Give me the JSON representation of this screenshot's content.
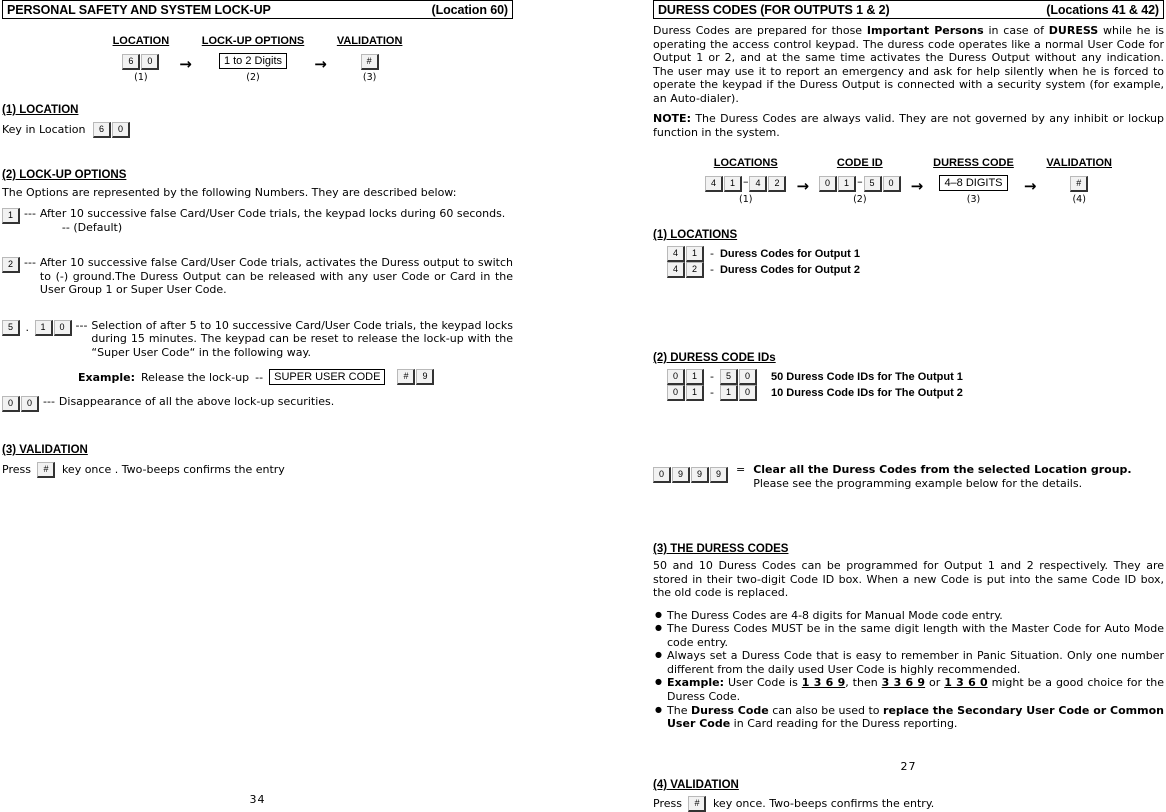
{
  "left": {
    "header": {
      "title": "PERSONAL SAFETY AND SYSTEM LOCK-UP",
      "location": "(Location 60)"
    },
    "flow": [
      {
        "title": "LOCATION",
        "keys": [
          "6",
          "0"
        ],
        "num": "(1)"
      },
      {
        "title": "LOCK-UP OPTIONS",
        "box": "1 to 2 Digits",
        "num": "(2)"
      },
      {
        "title": "VALIDATION",
        "keys": [
          "#"
        ],
        "num": "(3)"
      }
    ],
    "arrow": "→",
    "s1": {
      "heading": "(1) LOCATION",
      "text": "Key in Location",
      "keys": [
        "6",
        "0"
      ]
    },
    "s2": {
      "heading": "(2)  LOCK-UP OPTIONS",
      "intro": "The Options are represented by the following Numbers. They are described below:",
      "opt1": {
        "keys": [
          "1"
        ],
        "dots": "---",
        "text": "After 10 successive false Card/User Code trials, the keypad locks during 60 seconds.",
        "text2": "-- (Default)"
      },
      "opt2": {
        "keys": [
          "2"
        ],
        "dots": "---",
        "text": "After 10 successive false Card/User Code trials, activates the Duress output to switch to (-) ground.The Duress Output can be released with any user Code or Card in the User Group 1 or Super User Code."
      },
      "opt3": {
        "key_a": [
          "5"
        ],
        "dot": ".",
        "key_b": [
          "1",
          "0"
        ],
        "dots": "---",
        "text": "Selection of after 5 to 10 successive Card/User Code trials, the keypad locks during 15 minutes. The keypad can be reset to release the lock-up with the “Super User Code“ in the following way."
      },
      "example": {
        "label": "Example:",
        "text": "Release the lock-up",
        "dashes": "--",
        "box": "SUPER USER CODE",
        "keys": [
          "#",
          "9"
        ]
      },
      "opt4": {
        "keys": [
          "0",
          "0"
        ],
        "dots": "---",
        "text": "Disappearance of all the above lock-up securities."
      }
    },
    "s3": {
      "heading": "(3) VALIDATION",
      "before": "Press",
      "key": "#",
      "after": "key once . Two-beeps confirms the entry"
    },
    "page_number": "34"
  },
  "right": {
    "header": {
      "title": "DURESS CODES  (FOR OUTPUTS 1 & 2)",
      "location": "(Locations 41 & 42)"
    },
    "intro_parts": [
      {
        "t": "Duress Codes are prepared for those ",
        "b": false
      },
      {
        "t": "Important Persons",
        "b": true
      },
      {
        "t": " in case of ",
        "b": false
      },
      {
        "t": "DURESS",
        "b": true
      },
      {
        "t": " while he is operating the access control keypad. The duress code operates like a normal User Code for Output 1 or 2, and at the same time activates the Duress Output without any indication. The user may use it to report an emergency and ask for help silently when he is forced to operate the keypad if the Duress Output is connected with a security system (for example, an Auto-dialer).",
        "b": false
      }
    ],
    "note": {
      "label": "NOTE:",
      "text": " The Duress Codes are always valid. They are not governed by any inhibit or lockup function in the system."
    },
    "flow": [
      {
        "title": "LOCATIONS",
        "range": [
          [
            "4",
            "1"
          ],
          [
            "4",
            "2"
          ]
        ],
        "num": "(1)"
      },
      {
        "title": "CODE ID",
        "range": [
          [
            "0",
            "1"
          ],
          [
            "5",
            "0"
          ]
        ],
        "num": "(2)"
      },
      {
        "title": "DURESS CODE",
        "box": "4–8 DIGITS",
        "num": "(3)"
      },
      {
        "title": "VALIDATION",
        "keys": [
          "#"
        ],
        "num": "(4)"
      }
    ],
    "arrow": "→",
    "s1": {
      "heading": "(1) LOCATIONS",
      "rows": [
        {
          "keys": [
            "4",
            "1"
          ],
          "sep": "-",
          "label": "Duress Codes for Output 1"
        },
        {
          "keys": [
            "4",
            "2"
          ],
          "sep": "-",
          "label": "Duress Codes for Output 2"
        }
      ]
    },
    "s2": {
      "heading": "(2) DURESS CODE IDs",
      "rows": [
        {
          "key_a": [
            "0",
            "1"
          ],
          "sep": "-",
          "key_b": [
            "5",
            "0"
          ],
          "label": "50 Duress Code IDs for The Output 1"
        },
        {
          "key_a": [
            "0",
            "1"
          ],
          "sep": "-",
          "key_b": [
            "1",
            "0"
          ],
          "label": "10 Duress Code IDs for The Output 2"
        }
      ]
    },
    "clear": {
      "keys": [
        "0",
        "9",
        "9",
        "9"
      ],
      "eq": "=",
      "line1": "Clear all the Duress Codes from the selected Location group.",
      "line2": "Please see the programming example below for the details."
    },
    "s3": {
      "heading": "(3) THE DURESS CODES",
      "para": "50 and 10 Duress Codes can be programmed for Output 1 and 2 respectively. They are stored in their two-digit Code ID box. When a new Code is put into the same Code ID box, the old code is replaced.",
      "bullets": [
        [
          {
            "t": "The Duress Codes are 4-8 digits for Manual Mode code entry.",
            "b": false
          }
        ],
        [
          {
            "t": "The Duress Codes MUST be in the same digit length with the Master Code for Auto Mode code entry.",
            "b": false
          }
        ],
        [
          {
            "t": "Always set a Duress Code that is easy to remember in Panic Situation. Only one number different from the daily used User Code is highly recommended.",
            "b": false
          }
        ],
        [
          {
            "t": "Example:",
            "b": true
          },
          {
            "t": " User Code is ",
            "b": false
          },
          {
            "t": "1 3 6 9",
            "b": true,
            "u": true
          },
          {
            "t": ", then ",
            "b": false
          },
          {
            "t": "3 3 6 9",
            "b": true,
            "u": true
          },
          {
            "t": " or ",
            "b": false
          },
          {
            "t": "1 3 6 0",
            "b": true,
            "u": true
          },
          {
            "t": " might be a good choice for the Duress Code.",
            "b": false
          }
        ],
        [
          {
            "t": "The ",
            "b": false
          },
          {
            "t": "Duress Code",
            "b": true
          },
          {
            "t": " can also be used to ",
            "b": false
          },
          {
            "t": "replace the Secondary User Code or Common User Code",
            "b": true
          },
          {
            "t": " in Card reading for the Duress reporting.",
            "b": false
          }
        ]
      ]
    },
    "s4": {
      "heading": "(4) VALIDATION",
      "before": "Press",
      "key": "#",
      "after": "key once. Two-beeps confirms the entry."
    },
    "page_number": "27"
  }
}
